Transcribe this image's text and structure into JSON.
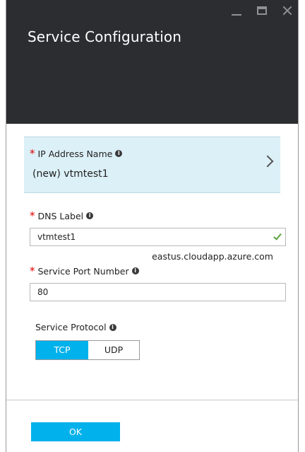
{
  "window": {
    "title": "Service Configuration",
    "controls": [
      "minimize-icon",
      "maximize-icon",
      "close-icon"
    ]
  },
  "ip_address": {
    "required_marker": "*",
    "label": "IP Address Name",
    "info": "i",
    "value": "(new) vtmtest1"
  },
  "dns": {
    "required_marker": "*",
    "label": "DNS Label",
    "info": "i",
    "value": "vtmtest1",
    "suffix": "eastus.cloudapp.azure.com"
  },
  "port": {
    "required_marker": "*",
    "label": "Service Port Number",
    "info": "i",
    "value": "80"
  },
  "protocol": {
    "label": "Service Protocol",
    "info": "i",
    "options": [
      "TCP",
      "UDP"
    ],
    "selected": "TCP"
  },
  "footer": {
    "ok_label": "OK"
  },
  "colors": {
    "header_bg": "#2b2d31",
    "accent": "#00b1eb",
    "selection_bg": "#dcf0f7",
    "required": "#e00000",
    "valid": "#5aa33e"
  }
}
